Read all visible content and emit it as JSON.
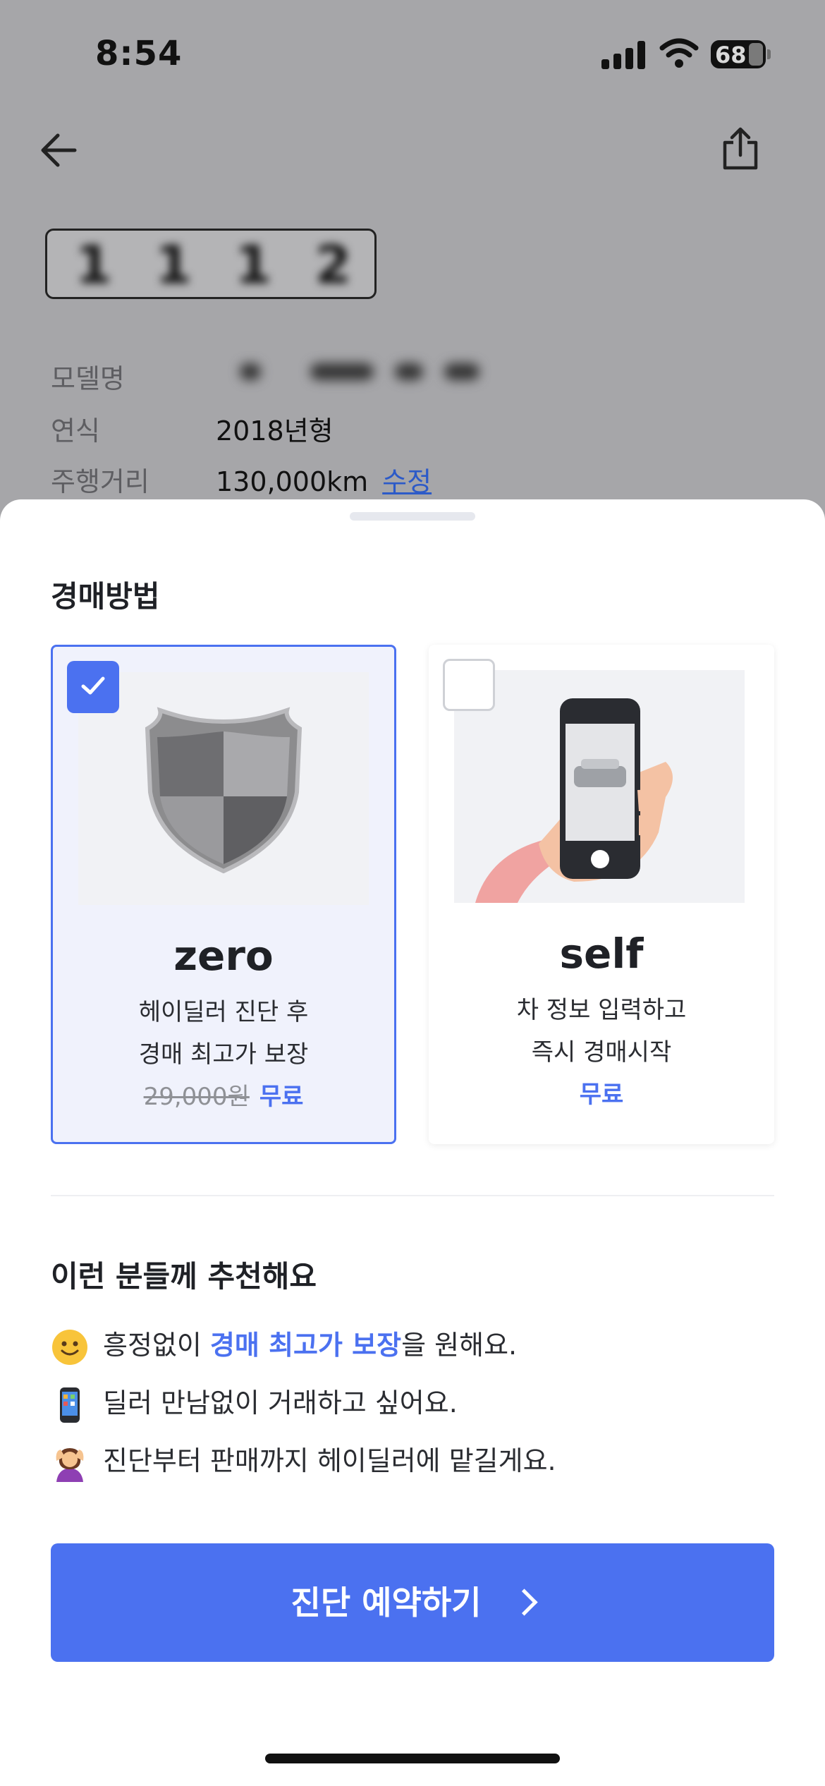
{
  "status_bar": {
    "time": "8:54",
    "battery": "68"
  },
  "background": {
    "info": [
      {
        "label": "모델명",
        "value": ""
      },
      {
        "label": "연식",
        "value": "2018년형"
      },
      {
        "label": "주행거리",
        "value": "130,000km",
        "link": "수정"
      }
    ]
  },
  "sheet": {
    "title": "경매방법",
    "options": [
      {
        "name": "zero",
        "desc_line1": "헤이딜러 진단 후",
        "desc_line2": "경매 최고가 보장",
        "original_price": "29,000원",
        "price": "무료",
        "selected": true
      },
      {
        "name": "self",
        "desc_line1": "차 정보 입력하고",
        "desc_line2": "즉시 경매시작",
        "original_price": "",
        "price": "무료",
        "selected": false
      }
    ],
    "recommend_title": "이런 분들께 추천해요",
    "recommend": [
      {
        "icon": "smile-emoji-icon",
        "pre": "흥정없이 ",
        "highlight": "경매 최고가 보장",
        "post": "을 원해요."
      },
      {
        "icon": "phone-emoji-icon",
        "pre": "딜러 만남없이 거래하고 싶어요.",
        "highlight": "",
        "post": ""
      },
      {
        "icon": "person-emoji-icon",
        "pre": "진단부터 판매까지 헤이딜러에 맡길게요.",
        "highlight": "",
        "post": ""
      }
    ],
    "cta_label": "진단 예약하기"
  },
  "colors": {
    "accent": "#4b71f0",
    "dim_background": "#a6a6a9"
  }
}
